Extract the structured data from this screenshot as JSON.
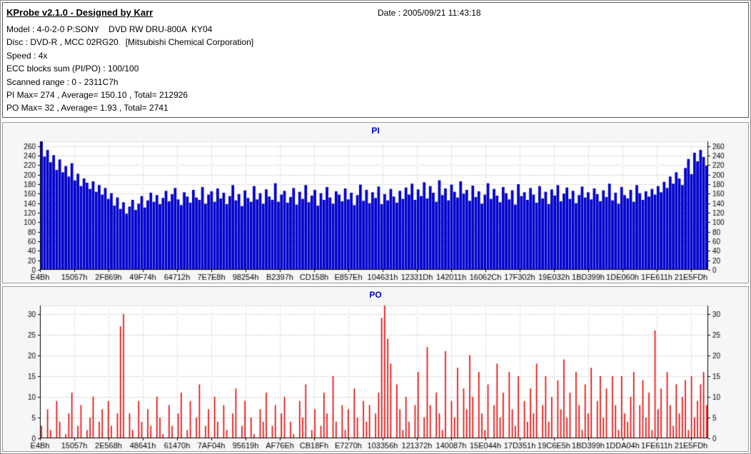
{
  "header": {
    "title": "KProbe v2.1.0 - Designed by Karr",
    "date_label": "Date : 2005/09/21 11:43:18",
    "info_lines": [
      "Model : 4-0-2-0 P:SONY    DVD RW DRU-800A  KY04",
      "Disc : DVD-R , MCC 02RG20   [Mitsubishi Chemical Corporation]",
      "Speed : 4x",
      "ECC blocks sum (PI/PO) : 100/100",
      "Scanned range : 0 - 2311C7h",
      "PI Max= 274 , Average= 150.10 , Total= 212926",
      "PO Max= 32 , Average= 1.93 , Total= 2741"
    ]
  },
  "chart_data": [
    {
      "type": "bar",
      "title": "PI",
      "title_color": "#0000cc",
      "bar_color": "#0000cc",
      "grid": true,
      "legend": "none",
      "ylim": [
        0,
        270
      ],
      "ytick_step": 20,
      "ytick_max": 260,
      "bar_width_frac": 0.88,
      "stats": {
        "max": 274,
        "average": 150.1,
        "total": 212926
      },
      "x_tick_labels": [
        "E4Bh",
        "15057h",
        "2F869h",
        "49F74h",
        "64712h",
        "7E7E8h",
        "98254h",
        "B2397h",
        "CD158h",
        "E857Eh",
        "104631h",
        "12331Dh",
        "142011h",
        "16062Ch",
        "17F302h",
        "19E032h",
        "1BD399h",
        "1DE060h",
        "1FE611h",
        "21E5FDh"
      ],
      "values": [
        274,
        238,
        252,
        226,
        241,
        210,
        232,
        205,
        218,
        196,
        224,
        188,
        202,
        176,
        192,
        183,
        170,
        186,
        164,
        178,
        158,
        172,
        149,
        161,
        135,
        152,
        128,
        142,
        118,
        133,
        147,
        126,
        139,
        155,
        131,
        146,
        162,
        143,
        157,
        138,
        151,
        166,
        144,
        159,
        172,
        148,
        136,
        163,
        154,
        141,
        168,
        152,
        147,
        174,
        139,
        158,
        165,
        143,
        171,
        150,
        162,
        138,
        155,
        178,
        146,
        159,
        134,
        167,
        151,
        143,
        176,
        148,
        161,
        139,
        169,
        154,
        147,
        182,
        143,
        158,
        166,
        141,
        153,
        172,
        137,
        164,
        149,
        178,
        142,
        156,
        168,
        135,
        161,
        147,
        174,
        152,
        139,
        165,
        158,
        144,
        171,
        148,
        162,
        136,
        157,
        179,
        145,
        168,
        140,
        163,
        151,
        175,
        138,
        159,
        146,
        170,
        154,
        141,
        166,
        149,
        173,
        158,
        181,
        147,
        169,
        155,
        184,
        150,
        176,
        162,
        143,
        188,
        157,
        171,
        146,
        179,
        164,
        152,
        186,
        160,
        168,
        145,
        177,
        153,
        165,
        139,
        158,
        182,
        149,
        170,
        156,
        142,
        174,
        161,
        148,
        167,
        137,
        180,
        155,
        163,
        147,
        172,
        158,
        141,
        176,
        150,
        164,
        138,
        169,
        156,
        178,
        144,
        160,
        173,
        149,
        166,
        140,
        157,
        175,
        152,
        163,
        148,
        171,
        159,
        144,
        167,
        153,
        181,
        146,
        162,
        139,
        174,
        157,
        150,
        168,
        143,
        178,
        161,
        147,
        165,
        154,
        170,
        158,
        176,
        163,
        185,
        172,
        196,
        181,
        205,
        192,
        178,
        214,
        233,
        201,
        246,
        228,
        252,
        237,
        219
      ]
    },
    {
      "type": "bar",
      "title": "PO",
      "title_color": "#0000cc",
      "bar_color": "#ee0000",
      "grid": true,
      "legend": "none",
      "ylim": [
        0,
        32
      ],
      "ytick_step": 5,
      "ytick_max": 30,
      "bar_width_frac": 0.38,
      "stats": {
        "max": 32,
        "average": 1.93,
        "total": 2741
      },
      "x_tick_labels": [
        "E4Bh",
        "15057h",
        "2E568h",
        "48641h",
        "61470h",
        "7AF04h",
        "95619h",
        "AF76Eh",
        "CB18Fh",
        "E7270h",
        "103356h",
        "121372h",
        "140087h",
        "15E044h",
        "17D351h",
        "19C6E5h",
        "1BD399h",
        "1DDA04h",
        "1FE611h",
        "21E5FDh"
      ],
      "values": [
        3,
        0,
        7,
        2,
        0,
        9,
        4,
        0,
        1,
        6,
        11,
        0,
        3,
        8,
        0,
        2,
        5,
        10,
        0,
        4,
        7,
        0,
        9,
        3,
        0,
        6,
        27,
        30,
        0,
        6,
        2,
        0,
        9,
        4,
        0,
        7,
        3,
        0,
        10,
        5,
        1,
        0,
        8,
        3,
        0,
        6,
        11,
        0,
        2,
        9,
        0,
        5,
        13,
        0,
        3,
        7,
        0,
        10,
        4,
        0,
        8,
        2,
        0,
        6,
        12,
        0,
        3,
        9,
        0,
        5,
        1,
        0,
        7,
        4,
        11,
        0,
        3,
        8,
        0,
        6,
        10,
        0,
        4,
        1,
        0,
        9,
        5,
        13,
        0,
        2,
        7,
        0,
        3,
        11,
        6,
        0,
        15,
        4,
        0,
        8,
        2,
        7,
        0,
        12,
        5,
        0,
        9,
        4,
        8,
        0,
        6,
        11,
        29,
        32,
        24,
        18,
        0,
        13,
        7,
        2,
        10,
        4,
        0,
        8,
        16,
        0,
        5,
        22,
        8,
        0,
        11,
        6,
        2,
        21,
        0,
        9,
        5,
        17,
        0,
        12,
        7,
        20,
        10,
        0,
        16,
        6,
        2,
        13,
        0,
        8,
        18,
        5,
        11,
        0,
        16,
        7,
        3,
        15,
        0,
        9,
        4,
        12,
        6,
        18,
        0,
        8,
        15,
        4,
        10,
        0,
        14,
        7,
        19,
        5,
        11,
        0,
        16,
        8,
        2,
        13,
        6,
        17,
        0,
        9,
        15,
        5,
        12,
        0,
        15,
        8,
        2,
        15,
        6,
        4,
        10,
        16,
        0,
        8,
        14,
        5,
        11,
        2,
        26,
        7,
        12,
        0,
        16,
        8,
        3,
        13,
        6,
        10,
        14,
        2,
        15,
        5,
        9,
        13,
        16,
        8
      ]
    }
  ]
}
